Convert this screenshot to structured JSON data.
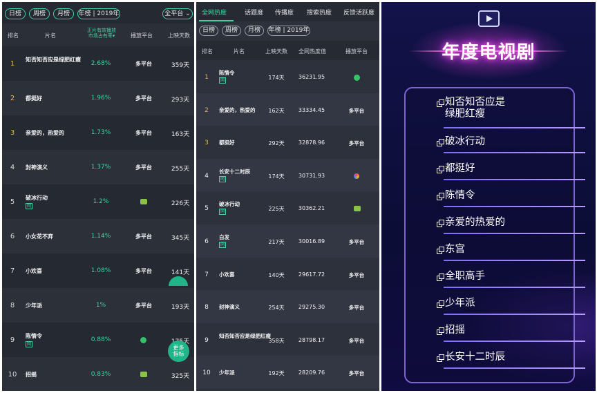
{
  "panel1": {
    "filters": [
      "日榜",
      "周榜",
      "月榜",
      "年榜 | 2019年"
    ],
    "platform_dropdown": "全平台",
    "columns": {
      "rank": "排名",
      "title": "片名",
      "share_line1": "正片有效播放",
      "share_line2": "市场占有率",
      "platform": "播放平台",
      "days": "上映天数"
    },
    "rows": [
      {
        "rank": "1",
        "title": "知否知否应是绿肥红瘦",
        "tag": "",
        "share": "2.68%",
        "platform": "多平台",
        "platform_icon": "",
        "days": "359天"
      },
      {
        "rank": "2",
        "title": "都挺好",
        "tag": "",
        "share": "1.96%",
        "platform": "多平台",
        "platform_icon": "",
        "days": "293天"
      },
      {
        "rank": "3",
        "title": "亲爱的，热爱的",
        "tag": "",
        "share": "1.73%",
        "platform": "多平台",
        "platform_icon": "",
        "days": "163天"
      },
      {
        "rank": "4",
        "title": "封神演义",
        "tag": "",
        "share": "1.37%",
        "platform": "多平台",
        "platform_icon": "",
        "days": "255天"
      },
      {
        "rank": "5",
        "title": "破冰行动",
        "tag": "网",
        "share": "1.2%",
        "platform": "",
        "platform_icon": "green-tv",
        "days": "226天"
      },
      {
        "rank": "6",
        "title": "小女花不弃",
        "tag": "",
        "share": "1.14%",
        "platform": "多平台",
        "platform_icon": "",
        "days": "345天"
      },
      {
        "rank": "7",
        "title": "小欢喜",
        "tag": "",
        "share": "1.08%",
        "platform": "多平台",
        "platform_icon": "",
        "days": "141天"
      },
      {
        "rank": "8",
        "title": "少年派",
        "tag": "",
        "share": "1%",
        "platform": "多平台",
        "platform_icon": "",
        "days": "193天"
      },
      {
        "rank": "9",
        "title": "陈情令",
        "tag": "网",
        "share": "0.88%",
        "platform": "",
        "platform_icon": "round-green",
        "days": "175天"
      },
      {
        "rank": "10",
        "title": "招摇",
        "tag": "",
        "share": "0.83%",
        "platform": "",
        "platform_icon": "green-tv",
        "days": "325天"
      }
    ],
    "more_button": "更多\n指标"
  },
  "panel2": {
    "tabs": [
      "全网热度",
      "话题度",
      "传播度",
      "搜索热度",
      "反馈活跃度"
    ],
    "filters": [
      "日榜",
      "周榜",
      "月榜",
      "年榜 | 2019年"
    ],
    "columns": {
      "rank": "排名",
      "title": "片名",
      "days": "上映天数",
      "heat": "全网热度值",
      "platform": "播放平台"
    },
    "rows": [
      {
        "rank": "1",
        "title": "陈情令",
        "tag": "网",
        "days": "174天",
        "heat": "36231.95",
        "platform": "",
        "platform_icon": "round-green"
      },
      {
        "rank": "2",
        "title": "亲爱的，热爱的",
        "tag": "",
        "days": "162天",
        "heat": "33334.45",
        "platform": "多平台",
        "platform_icon": ""
      },
      {
        "rank": "3",
        "title": "都挺好",
        "tag": "",
        "days": "292天",
        "heat": "32878.96",
        "platform": "多平台",
        "platform_icon": ""
      },
      {
        "rank": "4",
        "title": "长安十二时辰",
        "tag": "网",
        "days": "174天",
        "heat": "30731.93",
        "platform": "",
        "platform_icon": "rainbow"
      },
      {
        "rank": "5",
        "title": "破冰行动",
        "tag": "网",
        "days": "225天",
        "heat": "30362.21",
        "platform": "",
        "platform_icon": "green-tv"
      },
      {
        "rank": "6",
        "title": "白发",
        "tag": "网",
        "days": "217天",
        "heat": "30016.89",
        "platform": "多平台",
        "platform_icon": ""
      },
      {
        "rank": "7",
        "title": "小欢喜",
        "tag": "",
        "days": "140天",
        "heat": "29617.72",
        "platform": "多平台",
        "platform_icon": ""
      },
      {
        "rank": "8",
        "title": "封神演义",
        "tag": "",
        "days": "254天",
        "heat": "29275.30",
        "platform": "多平台",
        "platform_icon": ""
      },
      {
        "rank": "9",
        "title": "知否知否应是绿肥红瘦",
        "tag": "",
        "days": "358天",
        "heat": "28798.17",
        "platform": "多平台",
        "platform_icon": ""
      },
      {
        "rank": "10",
        "title": "少年派",
        "tag": "",
        "days": "192天",
        "heat": "28209.76",
        "platform": "多平台",
        "platform_icon": ""
      }
    ]
  },
  "panel3": {
    "title": "年度电视剧",
    "items": [
      "知否知否应是\n绿肥红瘦",
      "破冰行动",
      "都挺好",
      "陈情令",
      "亲爱的热爱的",
      "东宫",
      "全职高手",
      "少年派",
      "招摇",
      "长安十二时辰"
    ]
  },
  "colors": {
    "accent": "#41d3a4",
    "panel_bg": "#252932",
    "title_glow": "#ff5ccf",
    "list_border": "#7d62d8"
  }
}
